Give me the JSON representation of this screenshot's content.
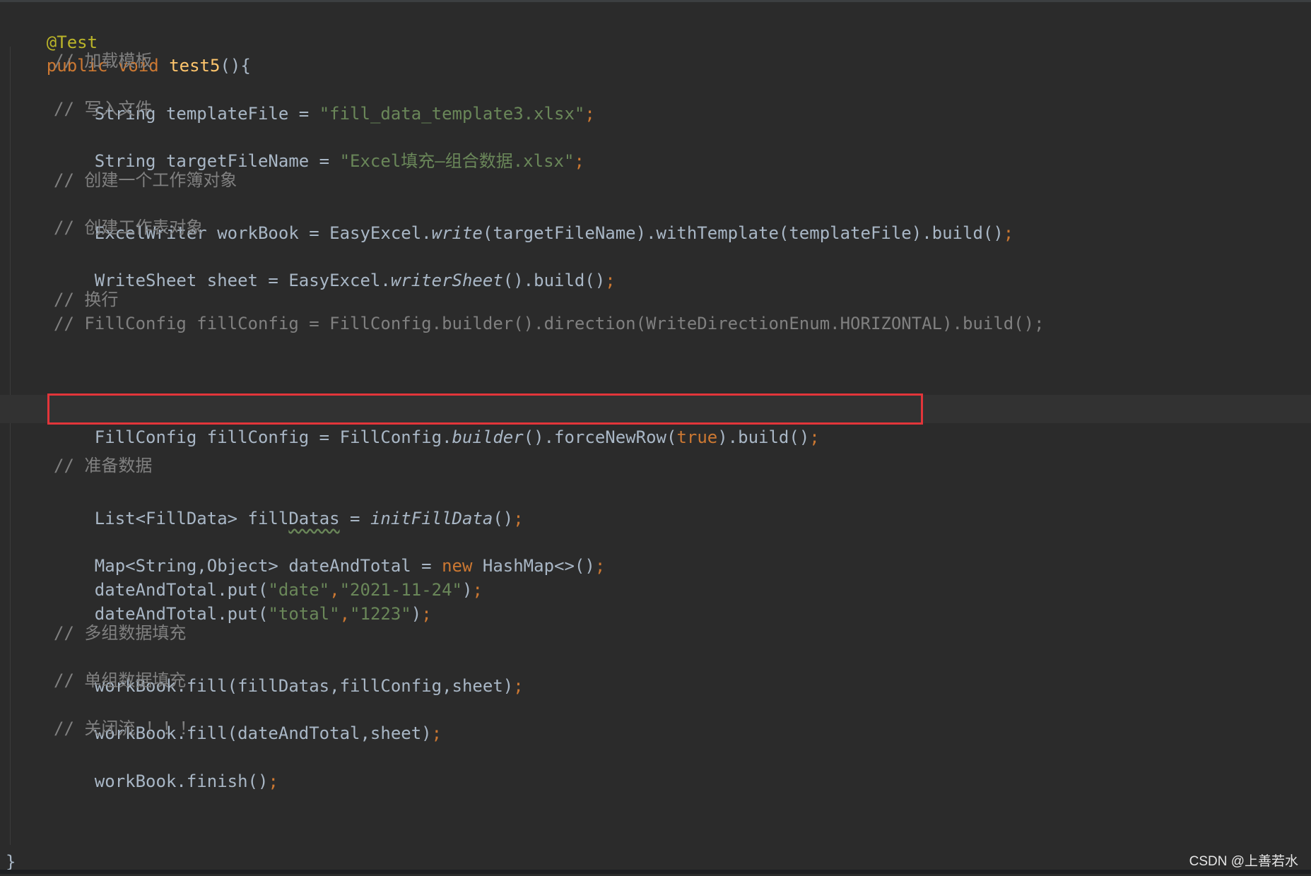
{
  "editor": {
    "annotation": "@Test",
    "signature": {
      "modifier": "public",
      "return_type": "void",
      "method_name": "test5",
      "params": "(){"
    },
    "comments": {
      "load_template": "// 加载模板",
      "write_file": "// 写入文件",
      "create_workbook": "// 创建一个工作簿对象",
      "create_sheet": "// 创建工作表对象",
      "newline": "// 换行",
      "fill_config_horizontal": "// FillConfig fillConfig = FillConfig.builder().direction(WriteDirectionEnum.HORIZONTAL).build();",
      "prepare_data": "// 准备数据",
      "multi_fill": "// 多组数据填充",
      "single_fill": "// 单组数据填充",
      "close_stream": "// 关闭流 ！！！"
    },
    "template_decl": {
      "prefix": "String templateFile = ",
      "value": "fill_data_template3.xlsx"
    },
    "target_decl": {
      "prefix": "String targetFileName = ",
      "value": "Excel填充—组合数据.xlsx"
    },
    "workbook_decl": {
      "prefix": "ExcelWriter workBook = EasyExcel.",
      "method": "write",
      "suffix": "(targetFileName).withTemplate(templateFile).build()"
    },
    "sheet_decl": {
      "prefix": "WriteSheet sheet = EasyExcel.",
      "method": "writerSheet",
      "suffix": "().build()"
    },
    "fillconfig_decl": {
      "prefix": "FillConfig fillConfig = FillConfig.",
      "method": "builder",
      "middle": "().forceNewRow(",
      "arg": "true",
      "suffix": ").build()"
    },
    "list_decl": {
      "prefix": "List<FillData> fill",
      "squiggle": "Datas",
      "middle": " = ",
      "method": "initFillData",
      "suffix": "()"
    },
    "map_decl": {
      "prefix": "Map<String,Object> dateAndTotal = ",
      "keyword": "new",
      "suffix": " HashMap<>()"
    },
    "put_date": {
      "prefix": "dateAndTotal.put(",
      "key": "\"date\"",
      "value": "\"2021-11-24\""
    },
    "put_total": {
      "prefix": "dateAndTotal.put(",
      "key": "\"total\"",
      "value": "\"1223\""
    },
    "fill_multi": "workBook.fill(fillDatas,fillConfig,sheet)",
    "fill_single": "workBook.fill(dateAndTotal,sheet)",
    "finish": "workBook.finish()",
    "closing_brace": "}"
  },
  "watermark": "CSDN @上善若水",
  "colors": {
    "background": "#2b2b2b",
    "keyword": "#cc7832",
    "string": "#6a8759",
    "comment": "#808080",
    "method_decl": "#ffc66d",
    "annotation": "#bbb529",
    "highlight_border": "#e2353a"
  }
}
